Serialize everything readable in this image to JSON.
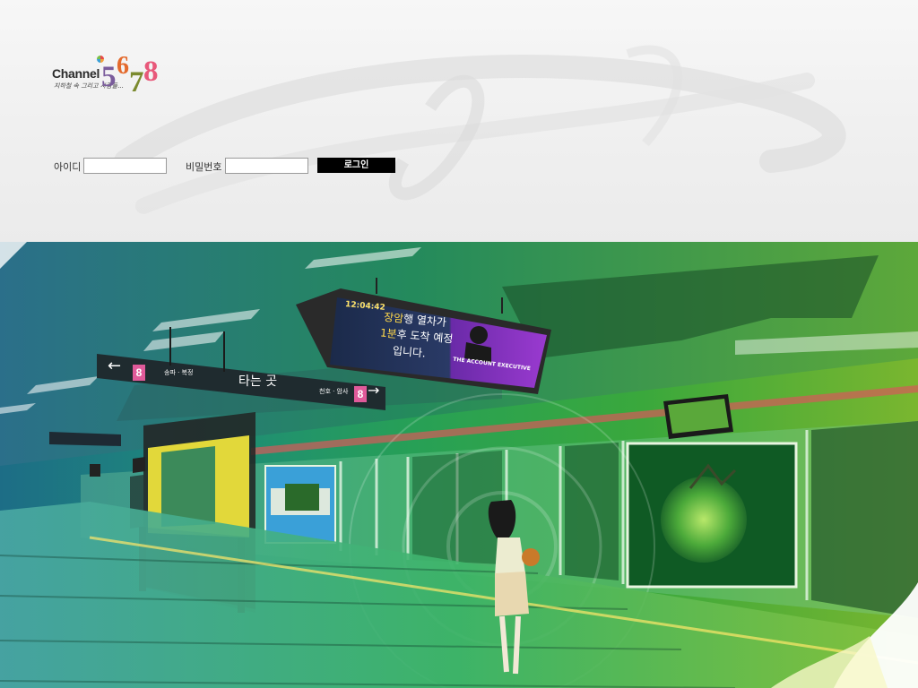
{
  "brand": {
    "word": "Channel",
    "digits": [
      "5",
      "6",
      "7",
      "8"
    ],
    "tagline": "지하철 속 그리고 사람들..."
  },
  "login": {
    "id_label": "아이디",
    "pw_label": "비밀번호",
    "id_value": "",
    "pw_value": "",
    "button": "로그인"
  },
  "scene": {
    "sign": {
      "line_number": "8",
      "left_destination": "송파 · 복정",
      "center": "타는 곳",
      "right_destination": "천호 · 암사",
      "right_line_number": "8"
    },
    "display": {
      "clock": "12:04:42",
      "msg_line1_hi": "장암",
      "msg_line1": "행 열차가",
      "msg_line2_hi": "1분",
      "msg_line2": "후 도착 예정",
      "msg_line3": "입니다.",
      "ad_caption": "THE ACCOUNT EXECUTIVE"
    }
  },
  "colors": {
    "line8": "#e05a9a",
    "login_button": "#000000"
  }
}
